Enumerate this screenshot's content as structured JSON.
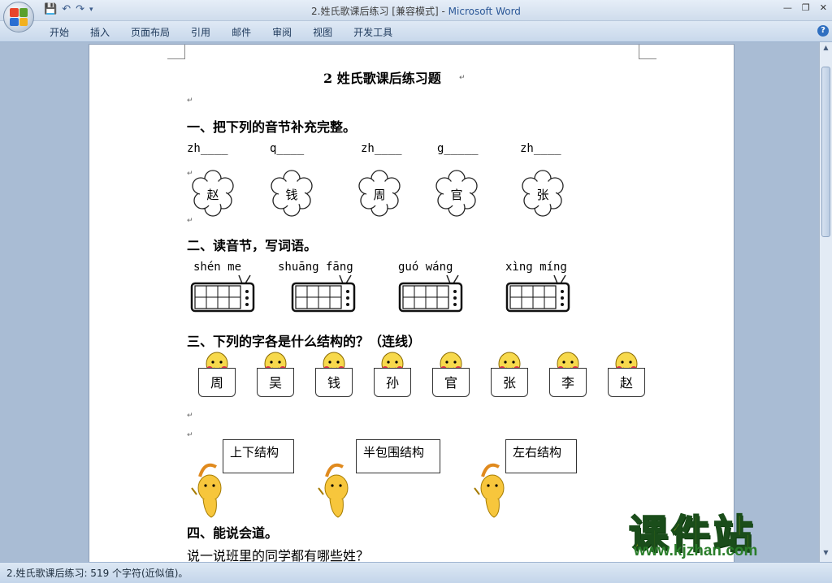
{
  "window": {
    "title_doc": "2.姓氏歌课后练习 [兼容模式]",
    "title_sep": " - ",
    "title_app": "Microsoft Word",
    "ribbon_tabs": [
      "开始",
      "插入",
      "页面布局",
      "引用",
      "邮件",
      "审阅",
      "视图",
      "开发工具"
    ]
  },
  "document": {
    "title": "2 姓氏歌课后练习题",
    "s1": {
      "heading": "一、把下列的音节补充完整。",
      "syllables": [
        "zh____",
        "q____",
        "zh____",
        "g_____",
        "zh____"
      ],
      "chars": [
        "赵",
        "钱",
        "周",
        "官",
        "张"
      ]
    },
    "s2": {
      "heading": "二、读音节，写词语。",
      "pinyin": [
        "shén me",
        "shuāng fāng",
        "guó wáng",
        "xìng míng"
      ]
    },
    "s3": {
      "heading": "三、下列的字各是什么结构的？（连线）",
      "chars": [
        "周",
        "吴",
        "钱",
        "孙",
        "官",
        "张",
        "李",
        "赵"
      ],
      "structures": [
        "上下结构",
        "半包围结构",
        "左右结构"
      ]
    },
    "s4": {
      "heading": "四、能说会道。",
      "prompt": "说一说班里的同学都有哪些姓？"
    }
  },
  "status": {
    "text": "2.姓氏歌课后练习: 519 个字符(近似值)。"
  },
  "watermark": {
    "brand": "课件站",
    "url": "www.kjzhan.com"
  },
  "colors": {
    "flower_fill": "#ffffff",
    "kid_face": "#f7d94c",
    "brand_yellow": "#f5e600",
    "brand_green": "#2a7d2a"
  }
}
